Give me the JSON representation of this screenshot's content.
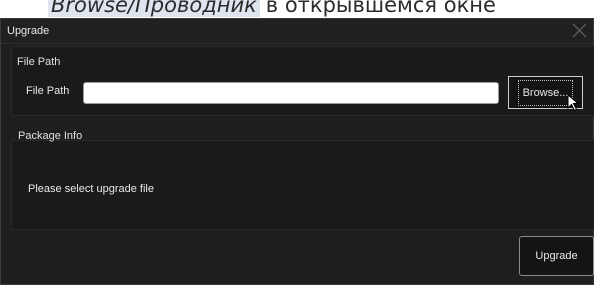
{
  "background": {
    "caption_highlight": "Browse/Проводник",
    "caption_rest": "в открывшемся окне"
  },
  "dialog": {
    "title": "Upgrade",
    "close_icon": "close-icon",
    "file_group": {
      "title": "File Path",
      "field_label": "File Path",
      "field_value": "",
      "browse_label": "Browse..."
    },
    "package_group": {
      "title": "Package Info",
      "status": "Please select upgrade file"
    },
    "upgrade_label": "Upgrade"
  },
  "colors": {
    "dialog_background": "#1e1e1e",
    "text": "#e6e6e6",
    "input_background": "#ffffff",
    "caption_highlight": "#dfe5ee"
  }
}
